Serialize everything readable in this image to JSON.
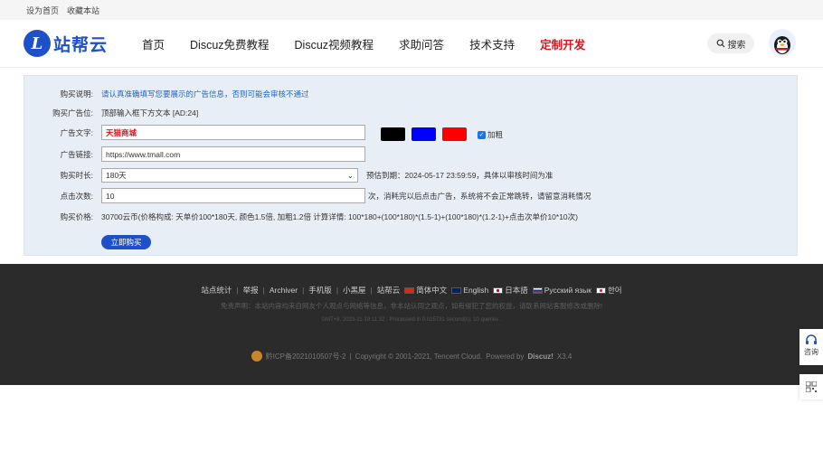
{
  "topbar": {
    "set_home": "设为首页",
    "bookmark": "收藏本站"
  },
  "logo": {
    "mark": "L",
    "text": "站帮云"
  },
  "nav": [
    {
      "label": "首页"
    },
    {
      "label": "Discuz免费教程"
    },
    {
      "label": "Discuz视频教程"
    },
    {
      "label": "求助问答"
    },
    {
      "label": "技术支持"
    },
    {
      "label": "定制开发"
    }
  ],
  "search": {
    "label": "搜索",
    "icon": "search-icon"
  },
  "form": {
    "instructions_label": "购买说明:",
    "instructions_value": "请认真准确填写您要展示的广告信息，否则可能会审核不通过",
    "position_label": "购买广告位:",
    "position_value": "顶部输入框下方文本 [AD:24]",
    "text_label": "广告文字:",
    "text_value": "天猫商城",
    "link_label": "广告链接:",
    "link_value": "https://www.tmall.com",
    "duration_label": "购买时长:",
    "duration_value": "180天",
    "expiry_text": "预估到期：2024-05-17 23:59:59，具体以审核时间为准",
    "clicks_label": "点击次数:",
    "clicks_value": "10",
    "clicks_note": "次，消耗完以后点击广告，系统将不会正常跳转，请留意消耗情况",
    "price_label": "购买价格:",
    "price_value": "30700云币(价格构成: 天单价100*180天, 颜色1.5倍, 加粗1.2倍  计算详情: 100*180+(100*180)*(1.5-1)+(100*180)*(1.2-1)+点击次单价10*10次)",
    "bold_label": "加粗",
    "buy_button": "立即购买",
    "colors": [
      "#000000",
      "#0000ff",
      "#ff0000"
    ]
  },
  "footer": {
    "links": [
      "站点统计",
      "举报",
      "Archiver",
      "手机版",
      "小黑屋",
      "站帮云"
    ],
    "langs": [
      {
        "label": "简体中文",
        "flag_color": "#de2910"
      },
      {
        "label": "English",
        "flag_color": "#012169"
      },
      {
        "label": "日本語",
        "flag_color": "#ffffff"
      },
      {
        "label": "Русский язык",
        "flag_color": "#0039a6"
      },
      {
        "label": "한어",
        "flag_color": "#cd2e3a"
      }
    ],
    "disclaimer": "免责声明：本站内容均来自网友个人观点与网络等信息，非本站认同之观点，如有侵犯了您的权益，请联系网站客服修改或删除!",
    "gmt": "GMT+8, 2023-11-19 11:32 , Processed in 0.015731 second(s), 10 queries .",
    "icp": "黔ICP备2021010507号-2",
    "copyright": "Copyright © 2001-2021, Tencent Cloud.",
    "powered_by": "Powered by",
    "discuz": "Discuz!",
    "version": "X3.4"
  },
  "side_tools": {
    "consult": "咨询"
  }
}
